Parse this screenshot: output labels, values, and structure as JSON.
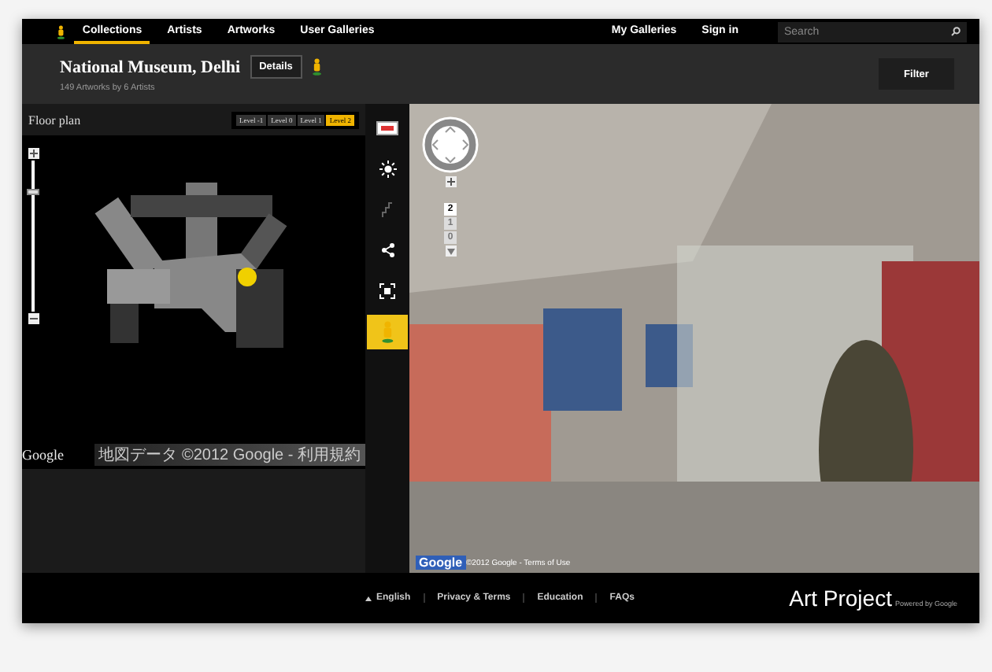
{
  "nav": {
    "items": [
      {
        "label": "Collections",
        "selected": true
      },
      {
        "label": "Artists",
        "selected": false
      },
      {
        "label": "Artworks",
        "selected": false
      },
      {
        "label": "User Galleries",
        "selected": false
      }
    ],
    "right_links": [
      "My Galleries",
      "Sign in"
    ],
    "search": {
      "placeholder": "Search"
    }
  },
  "header": {
    "title": "National Museum, Delhi",
    "details_button": "Details",
    "subtitle": "149 Artworks by 6 Artists",
    "filter_button": "Filter"
  },
  "floor_plan": {
    "title": "Floor plan",
    "levels": [
      {
        "label": "Level -1",
        "selected": false
      },
      {
        "label": "Level 0",
        "selected": false
      },
      {
        "label": "Level 1",
        "selected": false
      },
      {
        "label": "Level 2",
        "selected": true
      }
    ],
    "zoom": {
      "level": 0.8
    },
    "logo": "Google",
    "copyright": "地図データ ©2012 Google - 利用規約"
  },
  "tools": [
    {
      "kind": "card",
      "selected": false,
      "disabled": false
    },
    {
      "kind": "light",
      "selected": false,
      "disabled": false
    },
    {
      "kind": "stairs",
      "selected": false,
      "disabled": true
    },
    {
      "kind": "share",
      "selected": false,
      "disabled": false
    },
    {
      "kind": "fullscreen",
      "selected": false,
      "disabled": false
    },
    {
      "kind": "pegman",
      "selected": true,
      "disabled": false
    }
  ],
  "street_view": {
    "floors": [
      {
        "label": "2",
        "selected": true
      },
      {
        "label": "1",
        "selected": false
      },
      {
        "label": "0",
        "selected": false
      }
    ],
    "logo": "Google",
    "copyright": "©2012 Google - Terms of Use"
  },
  "footer": {
    "language": "English",
    "links": [
      "Privacy & Terms",
      "Education",
      "FAQs"
    ],
    "brand": "Art Project",
    "tagline": "Powered by Google"
  }
}
